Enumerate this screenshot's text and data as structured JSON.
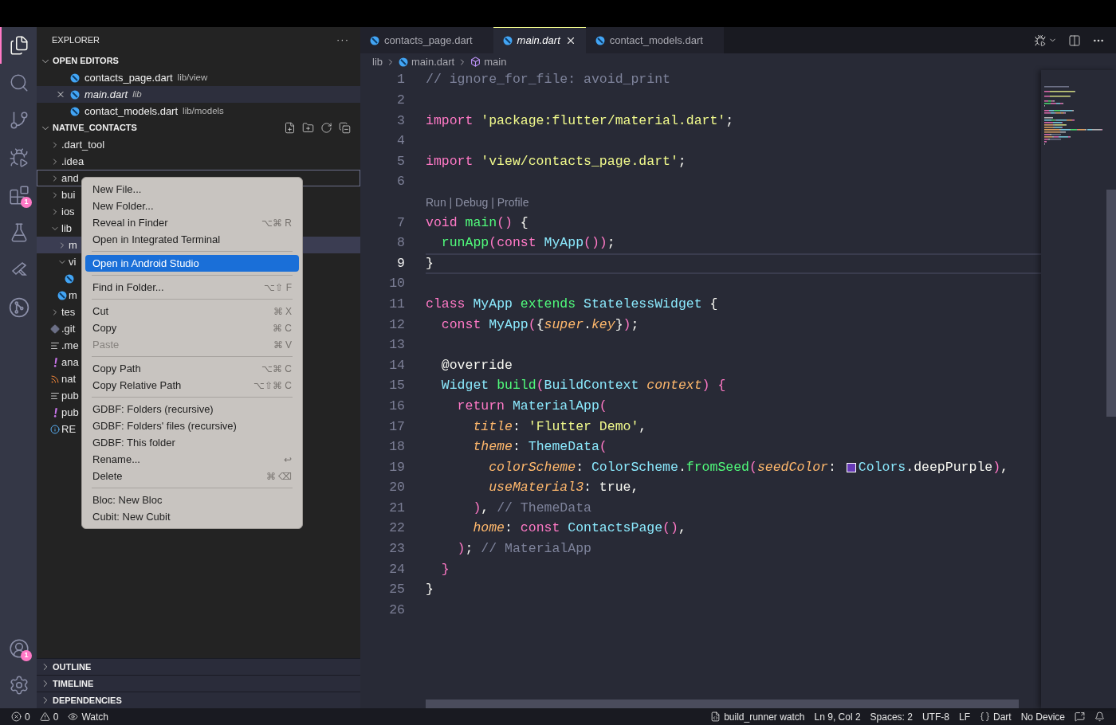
{
  "activity_bar": {
    "items": [
      {
        "kind": "files",
        "selected": true
      },
      {
        "kind": "search",
        "selected": false
      },
      {
        "kind": "source-control",
        "selected": false
      },
      {
        "kind": "run-debug",
        "selected": false
      },
      {
        "kind": "extensions",
        "selected": false,
        "badge": "1"
      },
      {
        "kind": "testing",
        "selected": false
      },
      {
        "kind": "flutter",
        "selected": false
      },
      {
        "kind": "git-graph",
        "selected": false
      }
    ],
    "bottom_items": [
      {
        "kind": "accounts",
        "badge": "1"
      },
      {
        "kind": "settings"
      }
    ]
  },
  "sidebar": {
    "title": "EXPLORER",
    "more": "···",
    "open_editors": {
      "title": "OPEN EDITORS",
      "expanded": true,
      "items": [
        {
          "name": "contacts_page.dart",
          "path": "lib/view",
          "selected": false,
          "preview": false
        },
        {
          "name": "main.dart",
          "path": "lib",
          "selected": true,
          "preview": true
        },
        {
          "name": "contact_models.dart",
          "path": "lib/models",
          "selected": false,
          "preview": false
        }
      ]
    },
    "project": {
      "title": "NATIVE_CONTACTS",
      "expanded": true,
      "items": [
        {
          "label": ".dart_tool",
          "kind": "folder",
          "expanded": false,
          "selected": false,
          "focused": false
        },
        {
          "label": ".idea",
          "kind": "folder",
          "expanded": false,
          "selected": false,
          "focused": false
        },
        {
          "label": "and",
          "kind": "folder",
          "expanded": false,
          "selected": false,
          "focused": true
        },
        {
          "label": "bui",
          "kind": "folder",
          "expanded": false,
          "selected": false,
          "focused": false
        },
        {
          "label": "ios",
          "kind": "folder",
          "expanded": false,
          "selected": false,
          "focused": false
        },
        {
          "label": "lib",
          "kind": "folder",
          "expanded": true,
          "selected": false,
          "focused": false,
          "children": [
            {
              "label": "m",
              "kind": "folder",
              "expanded": false,
              "selected": true,
              "focused": false
            },
            {
              "label": "vi",
              "kind": "folder",
              "expanded": true,
              "selected": false,
              "focused": false,
              "children": [
                {
                  "kind": "dart",
                  "selected": false,
                  "focused": false
                }
              ]
            },
            {
              "label": "m",
              "kind": "dart",
              "selected": false,
              "focused": false
            }
          ]
        },
        {
          "label": "tes",
          "kind": "folder",
          "expanded": false,
          "selected": false,
          "focused": false
        },
        {
          "label": ".git",
          "kind": "git",
          "selected": false,
          "focused": false
        },
        {
          "label": ".me",
          "kind": "text",
          "selected": false,
          "focused": false
        },
        {
          "label": "ana",
          "kind": "yaml",
          "selected": false,
          "focused": false
        },
        {
          "label": "nat",
          "kind": "feed",
          "selected": false,
          "focused": false
        },
        {
          "label": "pub",
          "kind": "text",
          "selected": false,
          "focused": false
        },
        {
          "label": "pub",
          "kind": "yaml",
          "selected": false,
          "focused": false
        },
        {
          "label": "RE",
          "kind": "info",
          "selected": false,
          "focused": false
        }
      ]
    },
    "panels": [
      {
        "title": "OUTLINE",
        "expanded": false
      },
      {
        "title": "TIMELINE",
        "expanded": false
      },
      {
        "title": "DEPENDENCIES",
        "expanded": false
      }
    ]
  },
  "context_menu": {
    "items": [
      {
        "kind": "item",
        "label": "New File...",
        "disabled": false,
        "selected": false
      },
      {
        "kind": "item",
        "label": "New Folder...",
        "disabled": false,
        "selected": false
      },
      {
        "kind": "item",
        "label": "Reveal in Finder",
        "shortcut": "⌥⌘ R",
        "disabled": false,
        "selected": false
      },
      {
        "kind": "item",
        "label": "Open in Integrated Terminal",
        "disabled": false,
        "selected": false
      },
      {
        "kind": "separator"
      },
      {
        "kind": "item",
        "label": "Open in Android Studio",
        "disabled": false,
        "selected": true
      },
      {
        "kind": "separator"
      },
      {
        "kind": "item",
        "label": "Find in Folder...",
        "shortcut": "⌥⇧ F",
        "disabled": false,
        "selected": false
      },
      {
        "kind": "separator"
      },
      {
        "kind": "item",
        "label": "Cut",
        "shortcut": "⌘ X",
        "disabled": false,
        "selected": false
      },
      {
        "kind": "item",
        "label": "Copy",
        "shortcut": "⌘ C",
        "disabled": false,
        "selected": false
      },
      {
        "kind": "item",
        "label": "Paste",
        "shortcut": "⌘ V",
        "disabled": true,
        "selected": false
      },
      {
        "kind": "separator"
      },
      {
        "kind": "item",
        "label": "Copy Path",
        "shortcut": "⌥⌘ C",
        "disabled": false,
        "selected": false
      },
      {
        "kind": "item",
        "label": "Copy Relative Path",
        "shortcut": "⌥⇧⌘ C",
        "disabled": false,
        "selected": false
      },
      {
        "kind": "separator"
      },
      {
        "kind": "item",
        "label": "GDBF: Folders (recursive)",
        "disabled": false,
        "selected": false
      },
      {
        "kind": "item",
        "label": "GDBF: Folders' files (recursive)",
        "disabled": false,
        "selected": false
      },
      {
        "kind": "item",
        "label": "GDBF: This folder",
        "disabled": false,
        "selected": false
      },
      {
        "kind": "item",
        "label": "Rename...",
        "shortcut": "↩",
        "disabled": false,
        "selected": false
      },
      {
        "kind": "item",
        "label": "Delete",
        "shortcut": "⌘ ⌫",
        "disabled": false,
        "selected": false
      },
      {
        "kind": "separator"
      },
      {
        "kind": "item",
        "label": "Bloc: New Bloc",
        "disabled": false,
        "selected": false
      },
      {
        "kind": "item",
        "label": "Cubit: New Cubit",
        "disabled": false,
        "selected": false
      }
    ]
  },
  "editor": {
    "tabs": [
      {
        "label": "contacts_page.dart",
        "selected": false,
        "preview": false
      },
      {
        "label": "main.dart",
        "selected": true,
        "preview": true
      },
      {
        "label": "contact_models.dart",
        "selected": false,
        "preview": false
      }
    ],
    "breadcrumb": [
      {
        "kind": "folder",
        "text": "lib"
      },
      {
        "kind": "dart",
        "text": "main.dart"
      },
      {
        "kind": "symbol",
        "text": "main"
      }
    ],
    "lines": [
      {
        "kind": "code",
        "number": "1",
        "current": false,
        "tokens": [
          {
            "kind": "comment",
            "text": "// ignore_for_file: avoid_print"
          }
        ]
      },
      {
        "kind": "code",
        "number": "2",
        "current": false
      },
      {
        "kind": "code",
        "number": "3",
        "current": false,
        "tokens": [
          {
            "kind": "keyword",
            "text": "import "
          },
          {
            "kind": "string",
            "text": "'package:flutter/material.dart'"
          },
          {
            "kind": "plain",
            "text": ";"
          }
        ]
      },
      {
        "kind": "code",
        "number": "4",
        "current": false
      },
      {
        "kind": "code",
        "number": "5",
        "current": false,
        "tokens": [
          {
            "kind": "keyword",
            "text": "import "
          },
          {
            "kind": "string",
            "text": "'view/contacts_page.dart'"
          },
          {
            "kind": "plain",
            "text": ";"
          }
        ]
      },
      {
        "kind": "code",
        "number": "6",
        "current": false
      },
      {
        "kind": "codelens",
        "text": "Run | Debug | Profile"
      },
      {
        "kind": "code",
        "number": "7",
        "current": false,
        "tokens": [
          {
            "kind": "keyword",
            "text": "void "
          },
          {
            "kind": "func",
            "text": "main"
          },
          {
            "kind": "punct",
            "text": "()"
          },
          {
            "kind": "plain",
            "text": " {"
          }
        ]
      },
      {
        "kind": "code",
        "number": "8",
        "current": false,
        "tokens": [
          {
            "kind": "func",
            "text": "  runApp"
          },
          {
            "kind": "punct",
            "text": "("
          },
          {
            "kind": "keyword",
            "text": "const "
          },
          {
            "kind": "type",
            "text": "MyApp"
          },
          {
            "kind": "punct",
            "text": "())"
          },
          {
            "kind": "plain",
            "text": ";"
          }
        ]
      },
      {
        "kind": "code",
        "number": "9",
        "current": true,
        "tokens": [
          {
            "kind": "plain",
            "text": "}"
          }
        ]
      },
      {
        "kind": "code",
        "number": "10",
        "current": false
      },
      {
        "kind": "code",
        "number": "11",
        "current": false,
        "tokens": [
          {
            "kind": "keyword",
            "text": "class "
          },
          {
            "kind": "type",
            "text": "MyApp "
          },
          {
            "kind": "func",
            "text": "extends "
          },
          {
            "kind": "type",
            "text": "StatelessWidget"
          },
          {
            "kind": "plain",
            "text": " {"
          }
        ]
      },
      {
        "kind": "code",
        "number": "12",
        "current": false,
        "tokens": [
          {
            "kind": "keyword",
            "text": "  const "
          },
          {
            "kind": "type",
            "text": "MyApp"
          },
          {
            "kind": "punct",
            "text": "("
          },
          {
            "kind": "plain",
            "text": "{"
          },
          {
            "kind": "param",
            "text": "super"
          },
          {
            "kind": "plain",
            "text": "."
          },
          {
            "kind": "param",
            "text": "key"
          },
          {
            "kind": "plain",
            "text": "}"
          },
          {
            "kind": "punct",
            "text": ")"
          },
          {
            "kind": "plain",
            "text": ";"
          }
        ]
      },
      {
        "kind": "code",
        "number": "13",
        "current": false
      },
      {
        "kind": "code",
        "number": "14",
        "current": false,
        "tokens": [
          {
            "kind": "plain",
            "text": "  @override"
          }
        ]
      },
      {
        "kind": "code",
        "number": "15",
        "current": false,
        "tokens": [
          {
            "kind": "type",
            "text": "  Widget "
          },
          {
            "kind": "func",
            "text": "build"
          },
          {
            "kind": "punct",
            "text": "("
          },
          {
            "kind": "type",
            "text": "BuildContext "
          },
          {
            "kind": "param",
            "text": "context"
          },
          {
            "kind": "punct",
            "text": ")"
          },
          {
            "kind": "punct",
            "text": " {"
          }
        ]
      },
      {
        "kind": "code",
        "number": "16",
        "current": false,
        "tokens": [
          {
            "kind": "keyword",
            "text": "    return "
          },
          {
            "kind": "type",
            "text": "MaterialApp"
          },
          {
            "kind": "punct",
            "text": "("
          }
        ]
      },
      {
        "kind": "code",
        "number": "17",
        "current": false,
        "tokens": [
          {
            "kind": "param",
            "text": "      title"
          },
          {
            "kind": "plain",
            "text": ": "
          },
          {
            "kind": "string",
            "text": "'Flutter Demo'"
          },
          {
            "kind": "plain",
            "text": ","
          }
        ]
      },
      {
        "kind": "code",
        "number": "18",
        "current": false,
        "tokens": [
          {
            "kind": "param",
            "text": "      theme"
          },
          {
            "kind": "plain",
            "text": ": "
          },
          {
            "kind": "type",
            "text": "ThemeData"
          },
          {
            "kind": "punct",
            "text": "("
          }
        ]
      },
      {
        "kind": "code",
        "number": "19",
        "current": false,
        "tokens": [
          {
            "kind": "param",
            "text": "        colorScheme"
          },
          {
            "kind": "plain",
            "text": ": "
          },
          {
            "kind": "type",
            "text": "ColorScheme"
          },
          {
            "kind": "plain",
            "text": "."
          },
          {
            "kind": "func",
            "text": "fromSeed"
          },
          {
            "kind": "punct",
            "text": "("
          },
          {
            "kind": "param",
            "text": "seedColor"
          },
          {
            "kind": "plain",
            "text": ": "
          },
          {
            "kind": "swatch",
            "color": "#673ab7"
          },
          {
            "kind": "type",
            "text": "Colors"
          },
          {
            "kind": "plain",
            "text": ".deepPurple"
          },
          {
            "kind": "punct",
            "text": ")"
          },
          {
            "kind": "plain",
            "text": ","
          }
        ]
      },
      {
        "kind": "code",
        "number": "20",
        "current": false,
        "tokens": [
          {
            "kind": "param",
            "text": "        useMaterial3"
          },
          {
            "kind": "plain",
            "text": ": true,"
          }
        ]
      },
      {
        "kind": "code",
        "number": "21",
        "current": false,
        "tokens": [
          {
            "kind": "punct",
            "text": "      )"
          },
          {
            "kind": "plain",
            "text": ", "
          },
          {
            "kind": "comment",
            "text": "// ThemeData"
          }
        ]
      },
      {
        "kind": "code",
        "number": "22",
        "current": false,
        "tokens": [
          {
            "kind": "param",
            "text": "      home"
          },
          {
            "kind": "plain",
            "text": ": "
          },
          {
            "kind": "keyword",
            "text": "const "
          },
          {
            "kind": "type",
            "text": "ContactsPage"
          },
          {
            "kind": "punct",
            "text": "()"
          },
          {
            "kind": "plain",
            "text": ","
          }
        ]
      },
      {
        "kind": "code",
        "number": "23",
        "current": false,
        "tokens": [
          {
            "kind": "punct",
            "text": "    )"
          },
          {
            "kind": "plain",
            "text": "; "
          },
          {
            "kind": "comment",
            "text": "// MaterialApp"
          }
        ]
      },
      {
        "kind": "code",
        "number": "24",
        "current": false,
        "tokens": [
          {
            "kind": "punct",
            "text": "  }"
          }
        ]
      },
      {
        "kind": "code",
        "number": "25",
        "current": false,
        "tokens": [
          {
            "kind": "plain",
            "text": "}"
          }
        ]
      },
      {
        "kind": "code",
        "number": "26",
        "current": false
      }
    ]
  },
  "status_bar": {
    "left": [
      {
        "kind": "errors",
        "text": "0"
      },
      {
        "kind": "warnings",
        "text": "0"
      },
      {
        "kind": "watch",
        "text": "Watch"
      }
    ],
    "right": [
      {
        "kind": "task",
        "text": "build_runner watch"
      },
      {
        "kind": "plain",
        "text": "Ln 9, Col 2"
      },
      {
        "kind": "plain",
        "text": "Spaces: 2"
      },
      {
        "kind": "plain",
        "text": "UTF-8"
      },
      {
        "kind": "plain",
        "text": "LF"
      },
      {
        "kind": "language",
        "text": "Dart"
      },
      {
        "kind": "plain",
        "text": "No Device"
      },
      {
        "kind": "feedback"
      },
      {
        "kind": "notifications"
      }
    ]
  }
}
